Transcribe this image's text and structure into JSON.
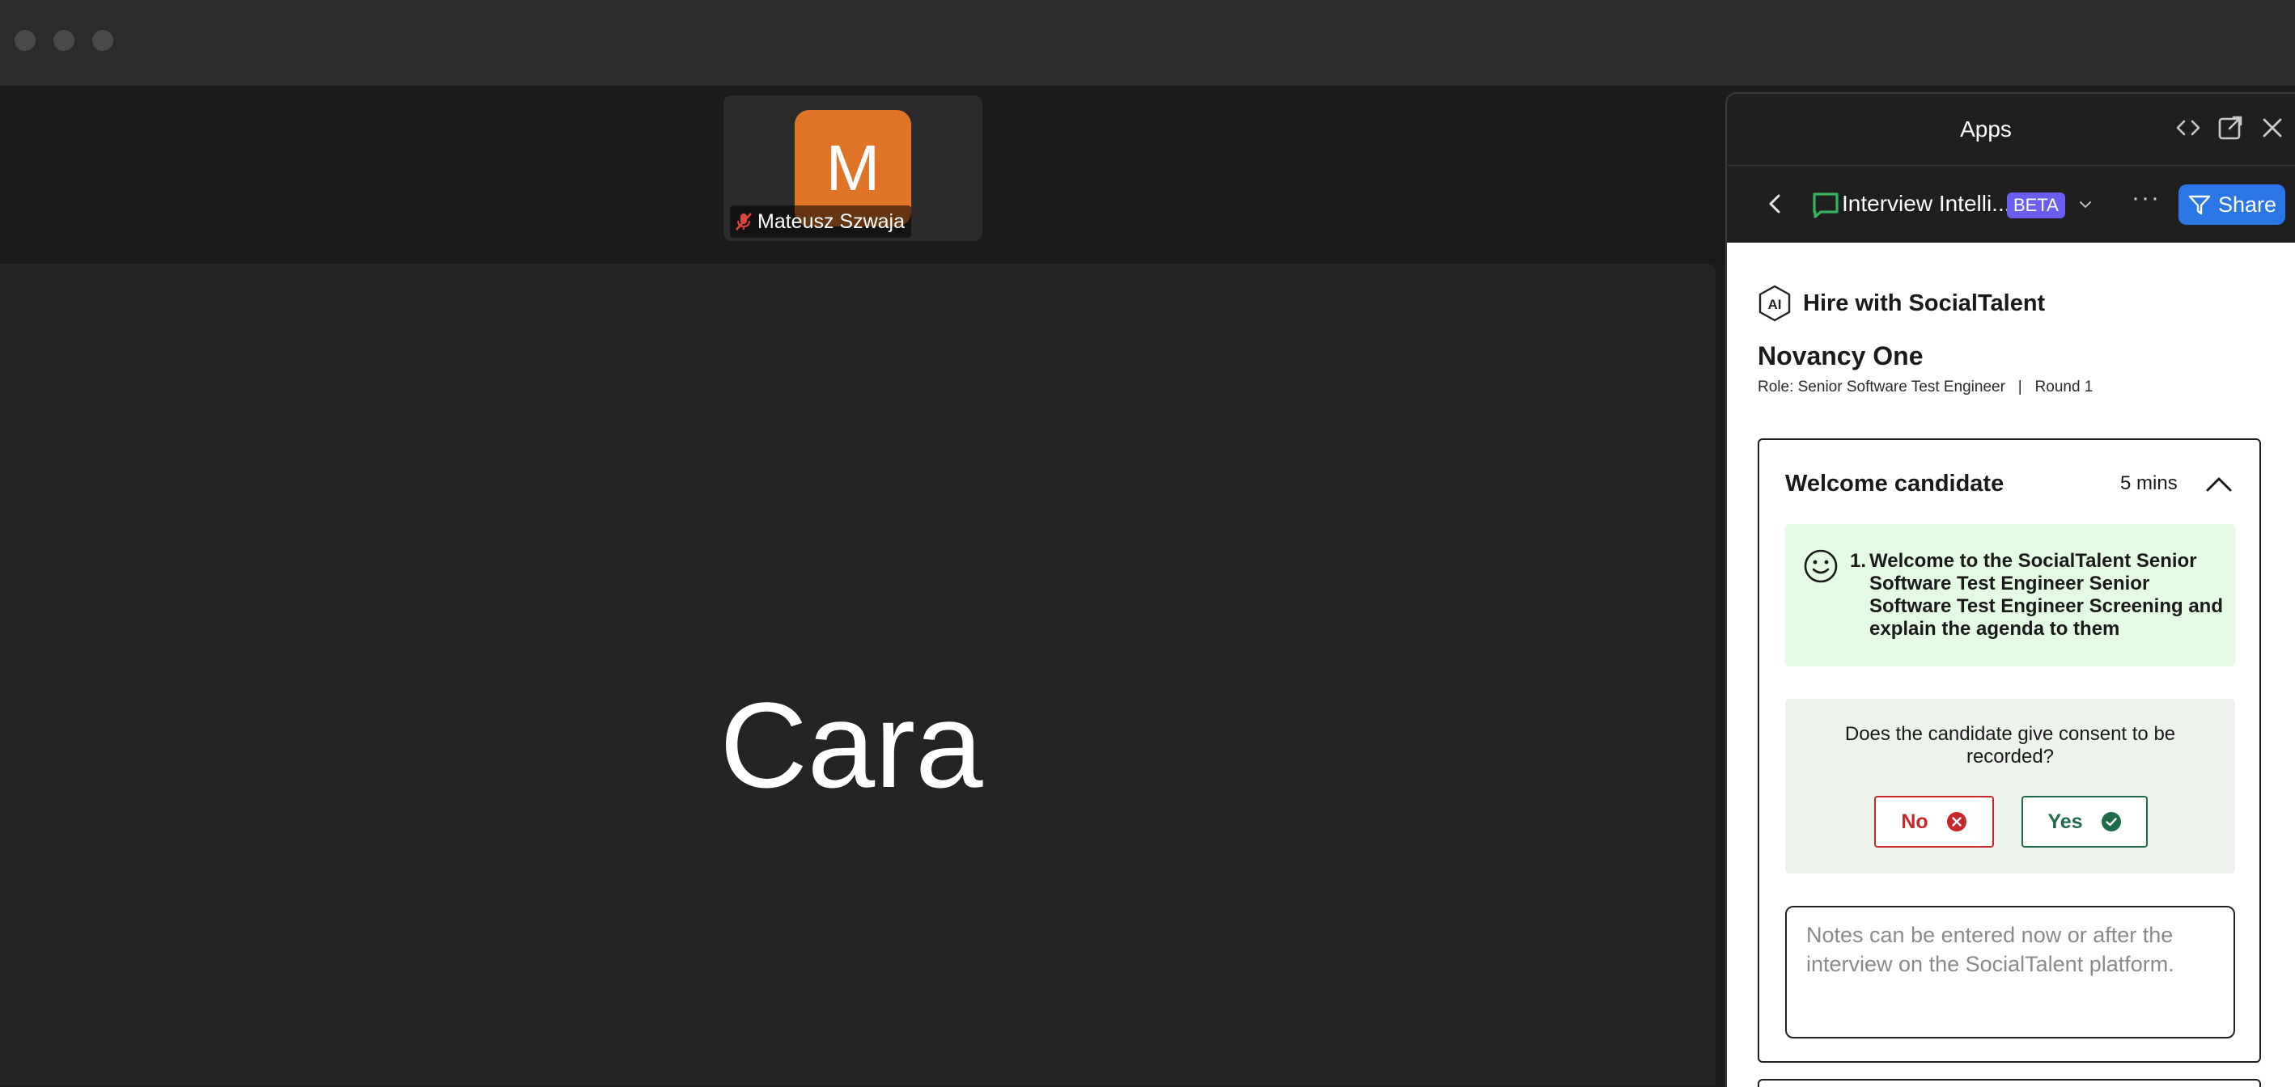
{
  "thumbnail": {
    "initial": "M",
    "name": "Mateusz Szwaja"
  },
  "main_tile": {
    "name": "Cara"
  },
  "apps_panel": {
    "title": "Apps",
    "app_name": "Interview Intelli...",
    "badge": "BETA",
    "share_label": "Share",
    "more_label": "···"
  },
  "content": {
    "brand": "Hire with SocialTalent",
    "brand_logo": "AI",
    "company": "Novancy One",
    "role": "Role: Senior Software Test Engineer   |   Round 1",
    "section": {
      "title": "Welcome candidate",
      "time": "5 mins",
      "question_number": "1.",
      "question_text": "Welcome to the SocialTalent Senior Software Test Engineer Senior Software Test Engineer Screening and explain the agenda to them",
      "consent_question": "Does the candidate give consent to be recorded?",
      "no_label": "No",
      "yes_label": "Yes",
      "notes_placeholder": "Notes can be entered now or after the interview on the SocialTalent platform."
    }
  },
  "colors": {
    "accent": "#2b76e5",
    "avatar": "#e07528",
    "beta": "#6a5df0",
    "no": "#c8282b",
    "yes": "#1e6b4a",
    "question_bg": "#e4fae4"
  }
}
